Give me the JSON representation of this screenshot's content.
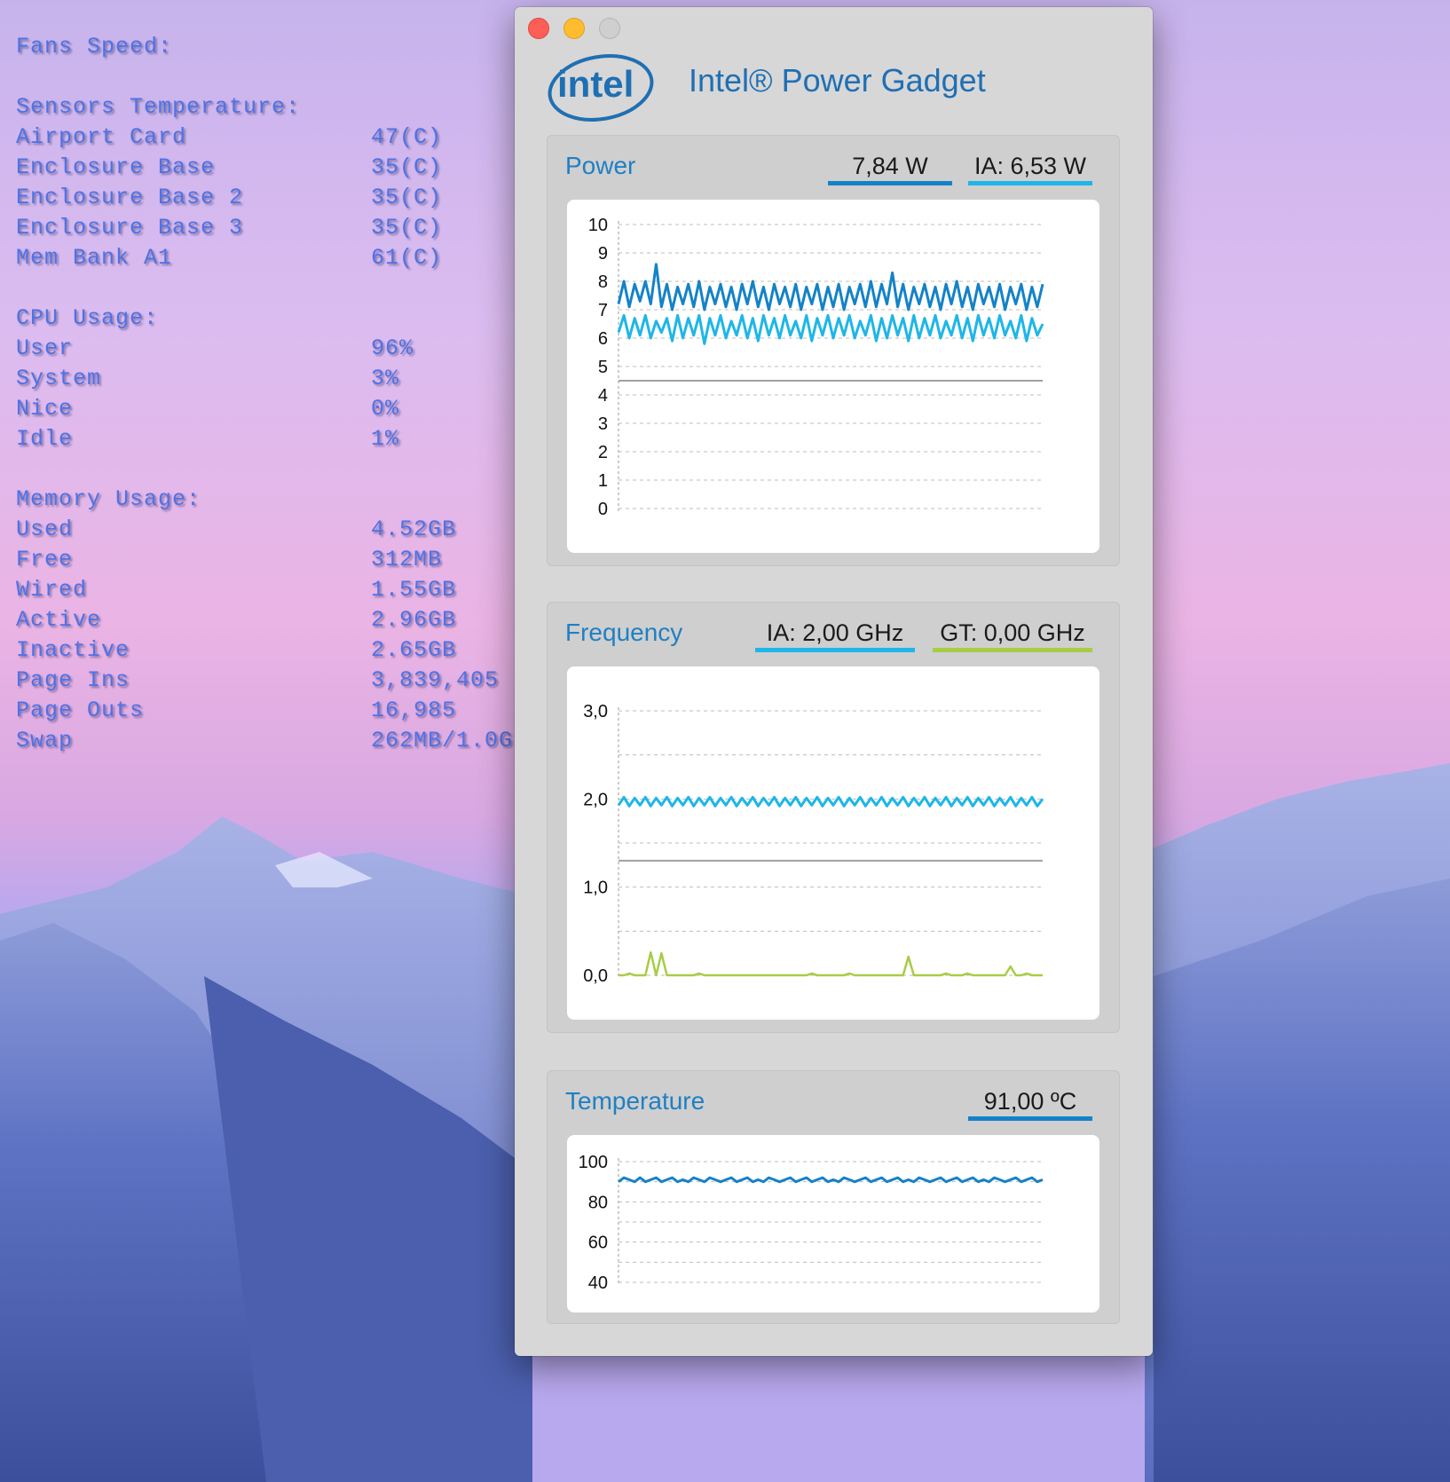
{
  "desktop": {
    "fans_label": "Fans Speed:",
    "sensors": {
      "heading": "Sensors Temperature:",
      "rows": [
        {
          "name": "Airport Card",
          "value": "47(C)"
        },
        {
          "name": "Enclosure Base",
          "value": "35(C)"
        },
        {
          "name": "Enclosure Base 2",
          "value": "35(C)"
        },
        {
          "name": "Enclosure Base 3",
          "value": "35(C)"
        },
        {
          "name": "Mem Bank A1",
          "value": "61(C)"
        }
      ]
    },
    "cpu": {
      "heading": "CPU Usage:",
      "rows": [
        {
          "name": "User",
          "value": "96%"
        },
        {
          "name": "System",
          "value": "3%"
        },
        {
          "name": "Nice",
          "value": "0%"
        },
        {
          "name": "Idle",
          "value": "1%"
        }
      ]
    },
    "memory": {
      "heading": "Memory Usage:",
      "rows": [
        {
          "name": "Used",
          "value": "4.52GB"
        },
        {
          "name": "Free",
          "value": "312MB"
        },
        {
          "name": "Wired",
          "value": "1.55GB"
        },
        {
          "name": "Active",
          "value": "2.96GB"
        },
        {
          "name": "Inactive",
          "value": "2.65GB"
        },
        {
          "name": "Page Ins",
          "value": "3,839,405"
        },
        {
          "name": "Page Outs",
          "value": "16,985"
        },
        {
          "name": "Swap",
          "value": "262MB/1.0G"
        }
      ]
    }
  },
  "window": {
    "title": "Intel® Power Gadget",
    "logo_text": "intel"
  },
  "colors": {
    "package_power": "#1482c8",
    "ia": "#1eb6e8",
    "gt": "#a8cc46",
    "limit_line": "#a0a0a0",
    "panel_title": "#1f7fc4"
  },
  "panels": {
    "power": {
      "title": "Power",
      "legend_total": "7,84 W",
      "legend_ia": "IA: 6,53 W"
    },
    "frequency": {
      "title": "Frequency",
      "legend_ia": "IA: 2,00 GHz",
      "legend_gt": "GT: 0,00 GHz"
    },
    "temperature": {
      "title": "Temperature",
      "legend": "91,00 ºC"
    }
  },
  "chart_data": [
    {
      "type": "line",
      "title": "Power",
      "ylim": [
        0,
        10
      ],
      "yticks": [
        "0",
        "1",
        "2",
        "3",
        "4",
        "5",
        "6",
        "7",
        "8",
        "9",
        "10"
      ],
      "grid": true,
      "legend_placement": "top-right",
      "series": [
        {
          "name": "7,84 W",
          "values": [
            7.2,
            8.0,
            7.1,
            7.9,
            7.3,
            8.0,
            7.2,
            8.6,
            7.1,
            7.9,
            7.0,
            7.8,
            7.2,
            7.9,
            7.1,
            8.0,
            7.0,
            7.8,
            7.2,
            7.9,
            7.1,
            7.8,
            7.0,
            7.9,
            7.2,
            8.0,
            7.1,
            7.8,
            7.0,
            7.9,
            7.2,
            7.8,
            7.1,
            7.9,
            7.0,
            7.8,
            7.2,
            7.9,
            7.0,
            7.8,
            7.1,
            7.9,
            7.0,
            7.8,
            7.2,
            7.9,
            7.1,
            8.0,
            7.1,
            7.9,
            7.2,
            8.3,
            7.1,
            7.9,
            7.0,
            7.8,
            7.2,
            7.9,
            7.1,
            7.8,
            7.0,
            7.9,
            7.2,
            8.0,
            7.1,
            7.8,
            7.0,
            7.9,
            7.2,
            7.8,
            7.1,
            7.9,
            7.0,
            7.8,
            7.2,
            7.9,
            7.0,
            7.8,
            7.1,
            7.9
          ]
        },
        {
          "name": "IA: 6,53 W",
          "values": [
            6.2,
            6.8,
            6.0,
            6.7,
            6.1,
            6.8,
            6.0,
            6.6,
            6.2,
            6.7,
            5.9,
            6.8,
            6.0,
            6.7,
            6.1,
            6.8,
            5.8,
            6.7,
            6.1,
            6.8,
            6.0,
            6.6,
            6.1,
            6.8,
            6.0,
            6.7,
            5.9,
            6.8,
            6.1,
            6.7,
            6.0,
            6.8,
            6.1,
            6.6,
            6.0,
            6.8,
            5.9,
            6.7,
            6.1,
            6.8,
            6.0,
            6.7,
            6.1,
            6.8,
            6.0,
            6.6,
            6.1,
            6.8,
            5.9,
            6.7,
            6.0,
            6.8,
            6.1,
            6.7,
            5.9,
            6.8,
            6.0,
            6.7,
            6.1,
            6.8,
            6.0,
            6.6,
            6.1,
            6.8,
            6.0,
            6.7,
            5.9,
            6.8,
            6.1,
            6.7,
            6.0,
            6.8,
            6.1,
            6.6,
            6.0,
            6.8,
            5.9,
            6.7,
            6.1,
            6.5
          ]
        },
        {
          "name": "",
          "values": [
            4.5,
            4.5
          ]
        }
      ]
    },
    {
      "type": "line",
      "title": "Frequency",
      "ylim": [
        0,
        3.0
      ],
      "yticks": [
        "0,0",
        "1,0",
        "2,0",
        "3,0"
      ],
      "grid": true,
      "legend_placement": "top-right",
      "series": [
        {
          "name": "IA: 2,00 GHz",
          "values": [
            1.93,
            2.02,
            1.92,
            2.01,
            1.93,
            2.02,
            1.92,
            2.01,
            1.93,
            2.02,
            1.92,
            2.01,
            1.93,
            2.02,
            1.92,
            2.01,
            1.93,
            2.02,
            1.92,
            2.01,
            1.93,
            2.02,
            1.92,
            2.01,
            1.93,
            2.02,
            1.92,
            2.01,
            1.93,
            2.02,
            1.92,
            2.01,
            1.93,
            2.02,
            1.92,
            2.01,
            1.93,
            2.02,
            1.92,
            2.01,
            1.93,
            2.02,
            1.92,
            2.01,
            1.93,
            2.02,
            1.92,
            2.01,
            1.93,
            2.02,
            1.92,
            2.01,
            1.93,
            2.02,
            1.92,
            2.01,
            1.93,
            2.02,
            1.92,
            2.01,
            1.93,
            2.02,
            1.92,
            2.01,
            1.93,
            2.02,
            1.92,
            2.01,
            1.93,
            2.02,
            1.92,
            2.01,
            1.93,
            2.02,
            1.92,
            2.01,
            1.93,
            2.02,
            1.92,
            2.0
          ]
        },
        {
          "name": "GT: 0,00 GHz",
          "values": [
            0,
            0,
            0.02,
            0,
            0,
            0,
            0.26,
            0,
            0.25,
            0,
            0,
            0,
            0,
            0,
            0,
            0.02,
            0,
            0,
            0,
            0,
            0,
            0,
            0,
            0,
            0,
            0,
            0,
            0,
            0,
            0,
            0,
            0,
            0,
            0,
            0,
            0,
            0.02,
            0,
            0,
            0,
            0,
            0,
            0,
            0.02,
            0,
            0,
            0,
            0,
            0,
            0,
            0,
            0,
            0,
            0,
            0.21,
            0,
            0,
            0,
            0,
            0,
            0,
            0.02,
            0,
            0,
            0,
            0.02,
            0,
            0,
            0,
            0,
            0,
            0,
            0,
            0.1,
            0,
            0,
            0.02,
            0,
            0,
            0
          ]
        },
        {
          "name": "",
          "values": [
            1.3,
            1.3
          ]
        }
      ]
    },
    {
      "type": "line",
      "title": "Temperature",
      "ylim": [
        40,
        100
      ],
      "yticks": [
        "40",
        "60",
        "80",
        "100"
      ],
      "grid": true,
      "legend_placement": "top-right",
      "series": [
        {
          "name": "91,00 ºC",
          "values": [
            90,
            92,
            91,
            90,
            92,
            90,
            91,
            92,
            90,
            91,
            92,
            90,
            91,
            90,
            92,
            91,
            90,
            92,
            91,
            90,
            91,
            92,
            90,
            91,
            92,
            90,
            91,
            90,
            92,
            91,
            90,
            91,
            92,
            90,
            91,
            92,
            90,
            91,
            92,
            90,
            91,
            90,
            92,
            91,
            90,
            91,
            92,
            90,
            91,
            92,
            90,
            91,
            92,
            90,
            91,
            90,
            92,
            91,
            90,
            91,
            92,
            90,
            91,
            92,
            90,
            91,
            92,
            90,
            91,
            90,
            92,
            91,
            90,
            91,
            92,
            90,
            91,
            92,
            90,
            91
          ]
        }
      ]
    }
  ]
}
